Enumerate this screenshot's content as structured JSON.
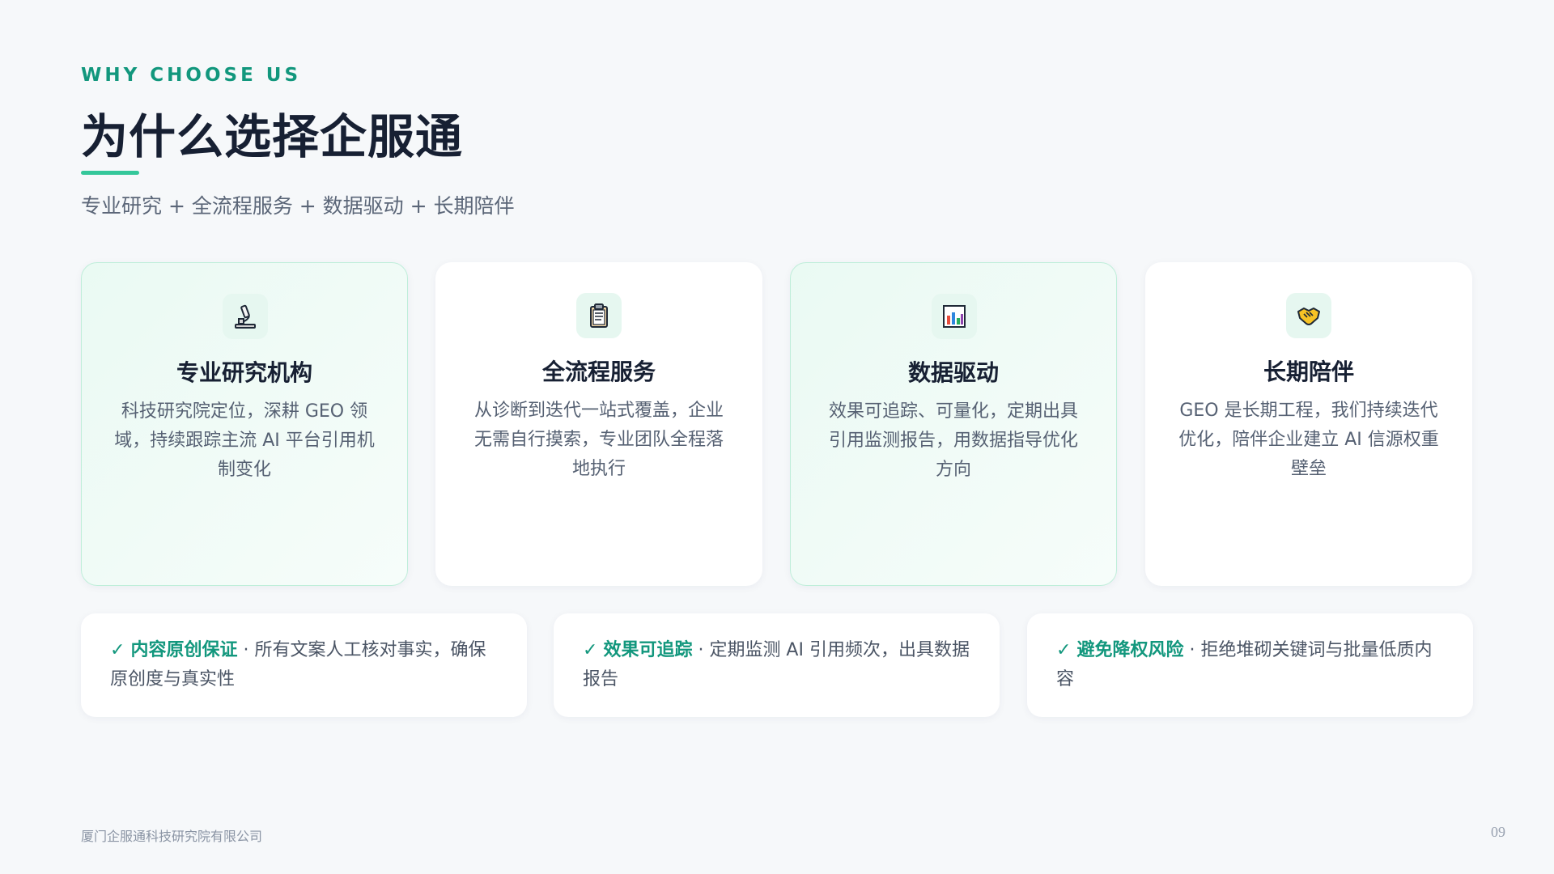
{
  "header": {
    "eyebrow": "WHY CHOOSE US",
    "title": "为什么选择企服通",
    "subtitle": "专业研究 + 全流程服务 + 数据驱动 + 长期陪伴"
  },
  "cards": [
    {
      "icon": "microscope-icon",
      "title": "专业研究机构",
      "description": "科技研究院定位，深耕 GEO 领域，持续跟踪主流 AI 平台引用机制变化"
    },
    {
      "icon": "clipboard-icon",
      "title": "全流程服务",
      "description": "从诊断到迭代一站式覆盖，企业无需自行摸索，专业团队全程落地执行"
    },
    {
      "icon": "bar-chart-icon",
      "title": "数据驱动",
      "description": "效果可追踪、可量化，定期出具引用监测报告，用数据指导优化方向"
    },
    {
      "icon": "handshake-icon",
      "title": "长期陪伴",
      "description": "GEO 是长期工程，我们持续迭代优化，陪伴企业建立 AI 信源权重壁垒"
    }
  ],
  "features": [
    {
      "check": "✓",
      "highlight": "内容原创保证",
      "separator": " · ",
      "text": "所有文案人工核对事实，确保原创度与真实性"
    },
    {
      "check": "✓",
      "highlight": "效果可追踪",
      "separator": " · ",
      "text": "定期监测 AI 引用频次，出具数据报告"
    },
    {
      "check": "✓",
      "highlight": "避免降权风险",
      "separator": " · ",
      "text": "拒绝堆砌关键词与批量低质内容"
    }
  ],
  "footer": {
    "company": "厦门企服通科技研究院有限公司",
    "page_number": "09"
  },
  "colors": {
    "accent": "#12977d",
    "accent_line": "#34c79a",
    "background": "#f6f8fa",
    "card_tint": "#eafaf3"
  }
}
